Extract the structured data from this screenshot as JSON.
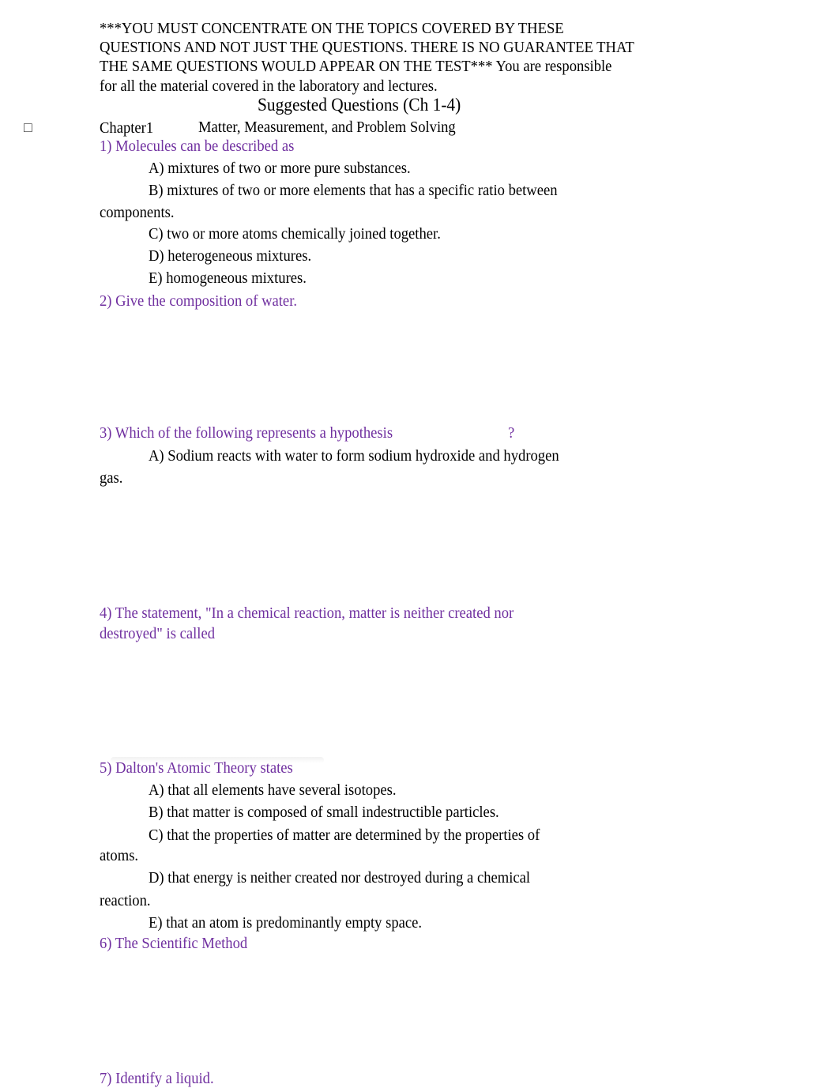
{
  "header": {
    "line1": "***YOU MUST CONCENTRATE ON THE TOPICS COVERED BY THESE",
    "line2": "QUESTIONS AND NOT JUST THE QUESTIONS. THERE IS NO GUARANTEE THAT",
    "line3": "THE SAME QUESTIONS WOULD APPEAR ON THE TEST*** You are responsible",
    "line4": "for all the material covered in the laboratory and lectures."
  },
  "title": "Suggested Questions (Ch 1-4)",
  "chapter": {
    "bullet": "□",
    "label": "Chapter1",
    "name": "Matter, Measurement, and Problem Solving"
  },
  "questions": [
    {
      "text": "1) Molecules can be described as",
      "options": [
        "A)   mixtures of two or more pure substances.",
        "B) mixtures of two or more elements that has a specific ratio between",
        "components.",
        "C) two or more atoms chemically joined together.",
        "D) heterogeneous mixtures.",
        "E) homogeneous mixtures."
      ]
    },
    {
      "text": "2) Give the composition of water."
    },
    {
      "text": "3) Which of the following represents a hypothesis",
      "suffix": "?",
      "options": [
        "A) Sodium reacts with water to form sodium hydroxide and hydrogen",
        "gas."
      ]
    },
    {
      "text_line1": "4) The statement, \"In a chemical reaction, matter is neither created nor",
      "text_line2": "destroyed\" is called"
    },
    {
      "text": "5) Dalton's Atomic Theory states",
      "options": [
        "A) that all elements have several isotopes.",
        "B) that matter is composed of small indestructible particles.",
        "C) that the properties of matter are determined by the properties of",
        "atoms.",
        "D) that energy is neither created nor destroyed during a chemical",
        "reaction.",
        "E) that an atom is predominantly empty space."
      ]
    },
    {
      "text": "6) The Scientific Method"
    },
    {
      "text": "7) Identify a liquid."
    }
  ]
}
